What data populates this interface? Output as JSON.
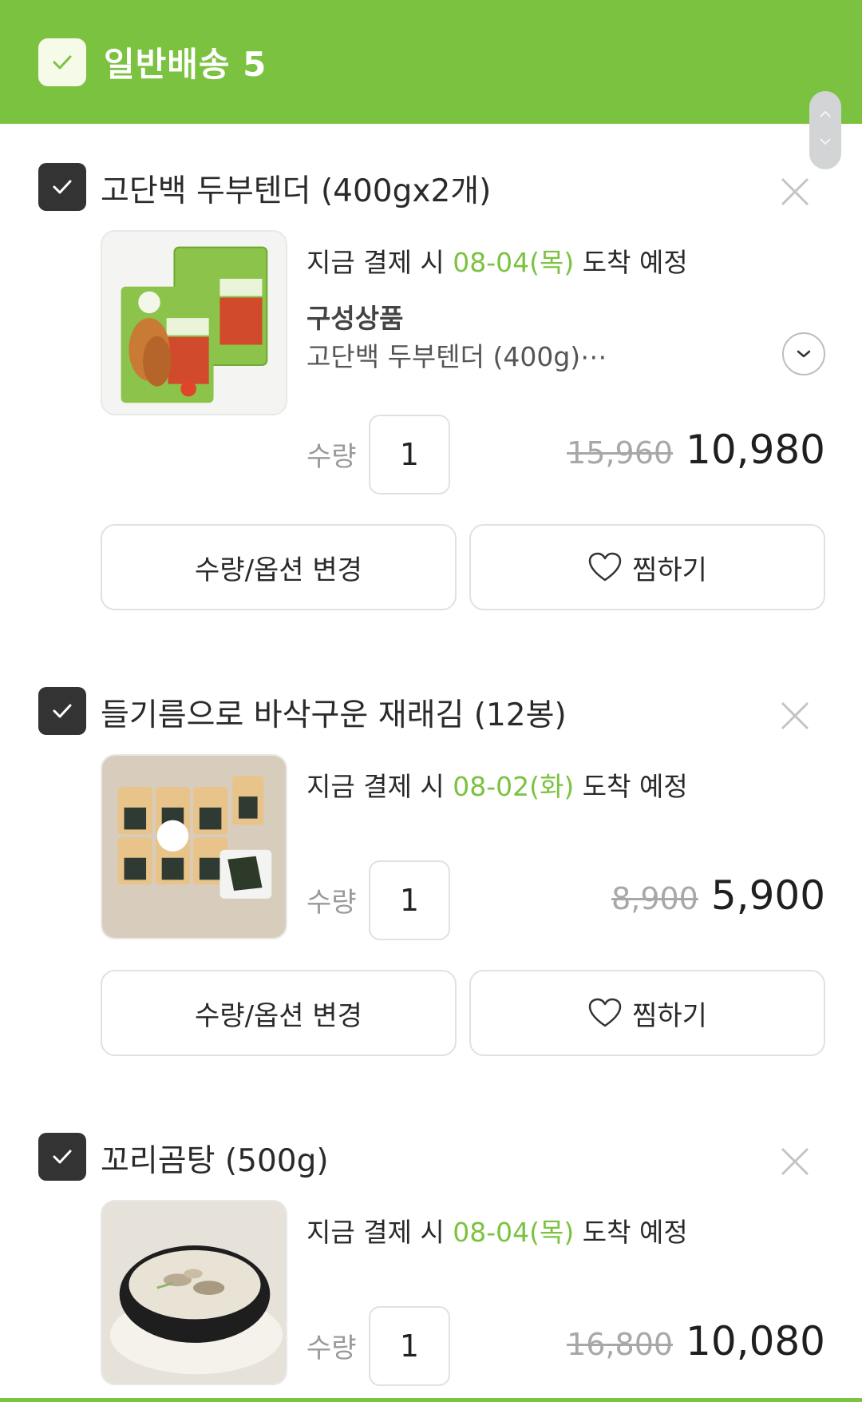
{
  "header": {
    "title": "일반배송 5"
  },
  "colors": {
    "brand": "#7cc241",
    "checkbox": "#333333"
  },
  "items": [
    {
      "name": "고단백 두부텐더 (400gx2개)",
      "delivery_prefix": "지금 결제 시 ",
      "delivery_date": "08-04(목)",
      "delivery_suffix": " 도착 예정",
      "composition_title": "구성상품",
      "composition_desc": "고단백 두부텐더 (400g)⋯",
      "qty_label": "수량",
      "qty": "1",
      "orig_price": "15,960",
      "price": "10,980",
      "option_button": "수량/옵션 변경",
      "wish_button": "찜하기"
    },
    {
      "name": "들기름으로 바삭구운 재래김 (12봉)",
      "delivery_prefix": "지금 결제 시 ",
      "delivery_date": "08-02(화)",
      "delivery_suffix": " 도착 예정",
      "qty_label": "수량",
      "qty": "1",
      "orig_price": "8,900",
      "price": "5,900",
      "option_button": "수량/옵션 변경",
      "wish_button": "찜하기"
    },
    {
      "name": "꼬리곰탕 (500g)",
      "delivery_prefix": "지금 결제 시 ",
      "delivery_date": "08-04(목)",
      "delivery_suffix": " 도착 예정",
      "qty_label": "수량",
      "qty": "1",
      "orig_price": "16,800",
      "price": "10,080"
    }
  ]
}
